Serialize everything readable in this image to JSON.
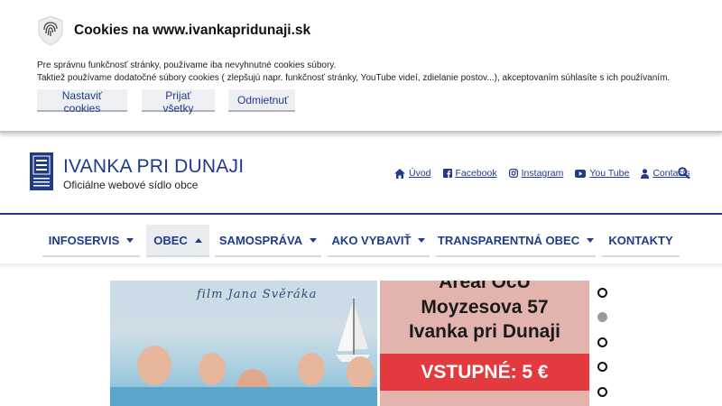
{
  "cookie": {
    "title": "Cookies na www.ivankapridunaji.sk",
    "line1": "Pre správnu funkčnosť stránky, používame iba nevyhnutné cookies súbory.",
    "line2": "Taktiež používame dodatočné súbory cookies ( zlepšujú napr. funkčnosť stránky, YouTube videí, zdielanie postov...), akceptovaním súhlasíte s ich používaním.",
    "btn_settings": "Nastaviť cookies",
    "btn_accept": "Prijať všetky",
    "btn_reject": "Odmietnuť"
  },
  "header": {
    "title": "IVANKA PRI DUNAJI",
    "subtitle": "Oficiálne webové sídlo obce"
  },
  "toplinks": [
    {
      "label": "Úvod",
      "icon": "home-icon"
    },
    {
      "label": "Facebook",
      "icon": "facebook-icon"
    },
    {
      "label": "Instagram",
      "icon": "instagram-icon"
    },
    {
      "label": "You Tube",
      "icon": "youtube-icon"
    },
    {
      "label": "Contacts",
      "icon": "person-icon"
    }
  ],
  "nav": [
    {
      "label": "INFOSERVIS"
    },
    {
      "label": "OBEC"
    },
    {
      "label": "SAMOSPRÁVA"
    },
    {
      "label": "AKO VYBAVIŤ"
    },
    {
      "label": "TRANSPARENTNÁ OBEC"
    },
    {
      "label": "KONTAKTY"
    }
  ],
  "slider": {
    "film_text": "film Jana Svěráka",
    "right_line1": "Areál OcÚ",
    "right_line2": "Moyzesova 57",
    "right_line3": "Ivanka pri Dunaji",
    "right_band": "VSTUPNÉ: 5 €",
    "active_dot": 2,
    "dot_count": 5
  },
  "colors": {
    "brand": "#1f3b8a",
    "band": "#e23a3e"
  }
}
